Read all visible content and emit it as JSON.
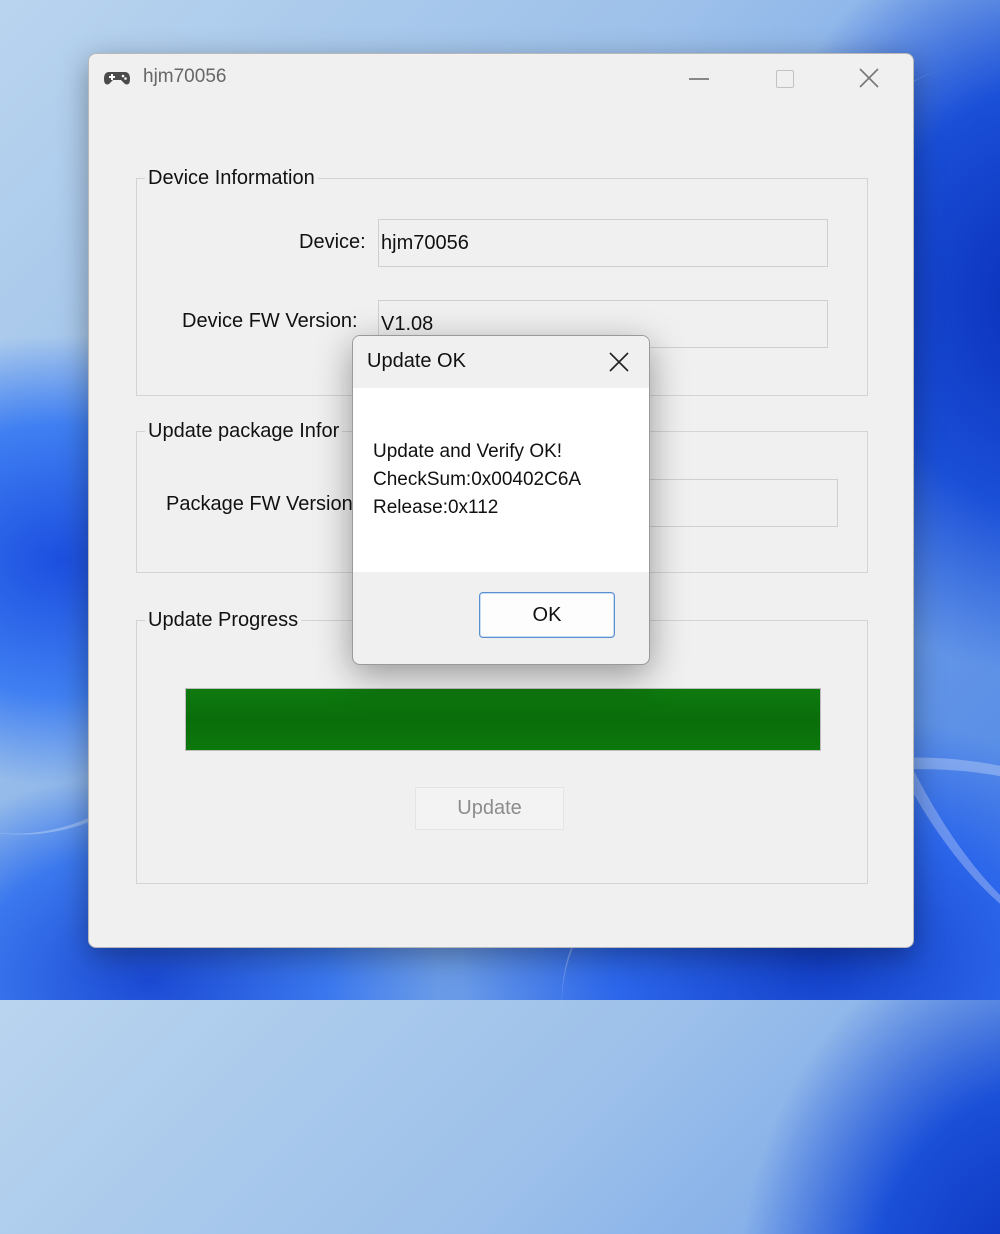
{
  "window": {
    "title": "hjm70056",
    "app_icon": "gamepad-icon",
    "controls": {
      "minimize": "minimize-icon",
      "maximize": "maximize-icon",
      "close": "close-icon"
    }
  },
  "device_info": {
    "group_title": "Device Information",
    "device_label": "Device:",
    "device_value": "hjm70056",
    "fw_label": "Device FW Version:",
    "fw_value": "V1.08"
  },
  "package_info": {
    "group_title": "Update package Infor",
    "package_fw_label": "Package FW Version"
  },
  "update_progress": {
    "group_title": "Update Progress",
    "progress_percent": 100,
    "progress_color": "#0b730b",
    "update_button_label": "Update"
  },
  "dialog": {
    "title": "Update OK",
    "messages": [
      "Update and Verify OK!",
      "CheckSum:0x00402C6A",
      "Release:0x112"
    ],
    "ok_label": "OK"
  }
}
